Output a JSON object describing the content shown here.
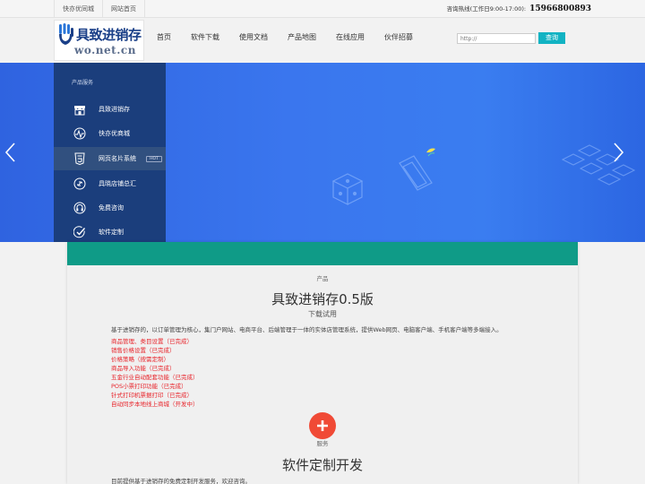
{
  "topbar": {
    "links": [
      "快亦优同城",
      "网站首页"
    ],
    "hotline_label": "咨询热线(工作日9:00-17:00):",
    "hotline_number": "15966800893"
  },
  "header": {
    "logo_cn": "具致进销存",
    "logo_en": "wo.net.cn",
    "nav": [
      "首页",
      "软件下载",
      "使用文档",
      "产品地图",
      "在线应用",
      "伙伴招募"
    ],
    "search_placeholder": "http://",
    "search_button": "查询"
  },
  "sidemenu": {
    "title": "产品服务",
    "items": [
      {
        "label": "具致进销存",
        "icon": "shop-icon"
      },
      {
        "label": "快亦优商城",
        "icon": "pulse-icon"
      },
      {
        "label": "网页名片系统",
        "icon": "html5-icon",
        "badge": "HOT",
        "active": true
      },
      {
        "label": "具晓店铺总汇",
        "icon": "link-icon"
      },
      {
        "label": "免费咨询",
        "icon": "headset-icon"
      },
      {
        "label": "软件定制",
        "icon": "check-icon"
      }
    ]
  },
  "colors": {
    "side_bg": "#1b3e7c",
    "teal": "#0f9b87",
    "search_btn": "#12b3c3",
    "feature_red": "#e8232a",
    "plus_red": "#f04a36"
  },
  "product": {
    "kicker": "产品",
    "title": "具致进销存0.5版",
    "subtitle": "下载试用",
    "description": "基于进销存的，以订单管理为核心，集门户网站、电商平台、后端管理于一体的实体店管理系统，提供Web网页、电脑客户端、手机客户端等多端接入。",
    "features": [
      "商品管理、类目设置（已完成）",
      "销售价格设置（已完成）",
      "价格策略（按需定制）",
      "商品导入功能（已完成）",
      "五金行业自动配套功能（已完成）",
      "POS小票打印功能（已完成）",
      "针式打印机票据打印（已完成）",
      "自动同步本地线上商城（开发中）"
    ]
  },
  "service": {
    "kicker": "服务",
    "title": "软件定制开发",
    "description": "目前提供基于进销存的免费定制开发服务，欢迎咨询。"
  }
}
